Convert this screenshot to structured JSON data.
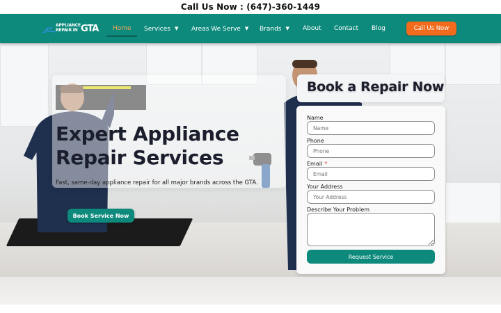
{
  "topbar": {
    "call_text": "Call Us Now : (647)-360-1449"
  },
  "logo": {
    "line1": "APPLIANCE",
    "line2": "REPAIR IN",
    "mark": "GTA",
    "icon": "lightning-bolt-icon"
  },
  "nav": {
    "items": [
      {
        "label": "Home",
        "active": true
      },
      {
        "label": "Services",
        "has_dropdown": true
      },
      {
        "label": "Areas We Serve",
        "has_dropdown": true
      },
      {
        "label": "Brands",
        "has_dropdown": true
      },
      {
        "label": "About"
      },
      {
        "label": "Contact"
      },
      {
        "label": "Blog"
      }
    ],
    "cta_label": "Call Us Now"
  },
  "hero": {
    "title": "Expert Appliance Repair Services",
    "subtitle": "Fast, same-day appliance repair for all major brands across the GTA.",
    "button_label": "Book Service Now"
  },
  "form": {
    "title": "Book a Repair Now",
    "fields": [
      {
        "label": "Name",
        "placeholder": "Name",
        "required": false
      },
      {
        "label": "Phone",
        "placeholder": "Phone",
        "required": false
      },
      {
        "label": "Email",
        "placeholder": "Email",
        "required": true,
        "required_mark": "*"
      },
      {
        "label": "Your Address",
        "placeholder": "Your Address",
        "required": false
      }
    ],
    "textarea_label": "Describe Your Problem",
    "submit_label": "Request Service"
  },
  "colors": {
    "brand": "#0e8a7d",
    "accent": "#f26b1d",
    "active_nav": "#f7a85a",
    "heading": "#1b1e2c"
  }
}
